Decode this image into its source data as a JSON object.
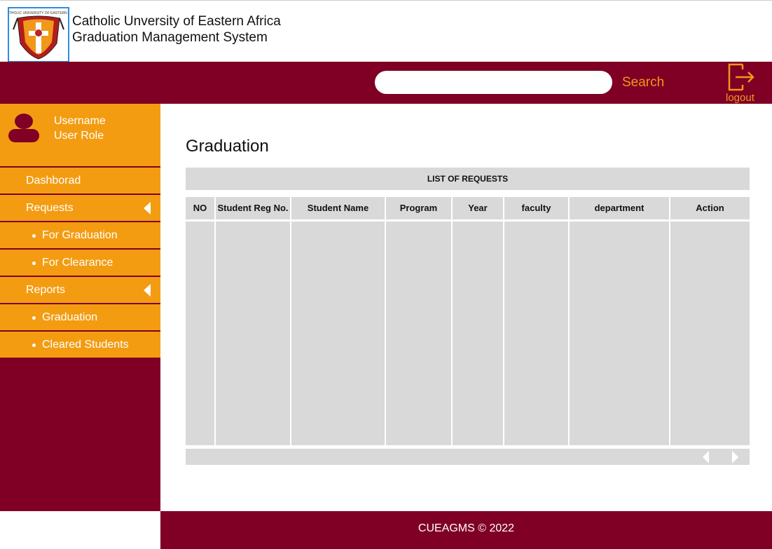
{
  "header": {
    "title_line1": "Catholic Unversity of Eastern Africa",
    "title_line2": "Graduation Management System"
  },
  "topbar": {
    "search_placeholder": "",
    "search_label": "Search",
    "logout_label": "logout",
    "background": "#7f0024",
    "accent": "#f0981a"
  },
  "sidebar": {
    "user": {
      "name": "Username",
      "role": "User Role"
    },
    "items": [
      {
        "label": "Dashborad"
      },
      {
        "label": "Requests"
      },
      {
        "label": "For Graduation"
      },
      {
        "label": "For Clearance"
      },
      {
        "label": "Reports"
      },
      {
        "label": "Graduation"
      },
      {
        "label": "Cleared Students"
      }
    ]
  },
  "main": {
    "title": "Graduation",
    "table_caption": "LIST OF REQUESTS",
    "columns": [
      "NO",
      "Student Reg No.",
      "Student Name",
      "Program",
      "Year",
      "faculty",
      "department",
      "Action"
    ],
    "rows": []
  },
  "footer": {
    "text": "CUEAGMS © 2022"
  }
}
